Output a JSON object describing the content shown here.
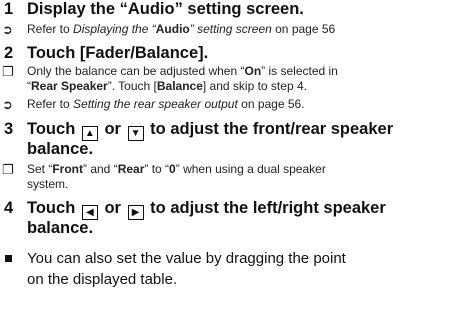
{
  "step1": {
    "num": "1",
    "title": "Display the “Audio” setting screen.",
    "ref_prefix": "Refer to ",
    "ref_italic_a": "Displaying the “",
    "ref_bold": "Audio",
    "ref_italic_b": "” setting screen",
    "ref_suffix": " on page 56"
  },
  "step2": {
    "num": "2",
    "title": "Touch [Fader/Balance].",
    "note_a": "Only the balance can be adjusted when “",
    "note_on": "On",
    "note_b": "” is selected in",
    "note_c": "“",
    "note_rear": "Rear Speaker",
    "note_d": "”. Touch [",
    "note_balance": "Balance",
    "note_e": "] and skip to step 4.",
    "ref_prefix": "Refer to ",
    "ref_italic": "Setting the rear speaker output",
    "ref_suffix": " on page 56."
  },
  "step3": {
    "num": "3",
    "touch": "Touch",
    "or": "or",
    "rest1": "to adjust the front/rear speaker",
    "rest2": "balance.",
    "up_icon": "▲",
    "down_icon": "▼",
    "note_a": "Set “",
    "note_front": "Front",
    "note_b": "” and “",
    "note_rear": "Rear",
    "note_c": "” to “",
    "note_zero": "0",
    "note_d": "” when using a dual speaker",
    "note_e": "system."
  },
  "step4": {
    "num": "4",
    "touch": "Touch",
    "or": "or",
    "rest1": "to adjust the left/right speaker",
    "rest2": "balance.",
    "left_icon": "◀",
    "right_icon": "▶"
  },
  "bullet": {
    "line1": "You can also set the value by dragging the point",
    "line2": "on the displayed table."
  },
  "icons": {
    "ref": "➲",
    "note": "❐"
  }
}
